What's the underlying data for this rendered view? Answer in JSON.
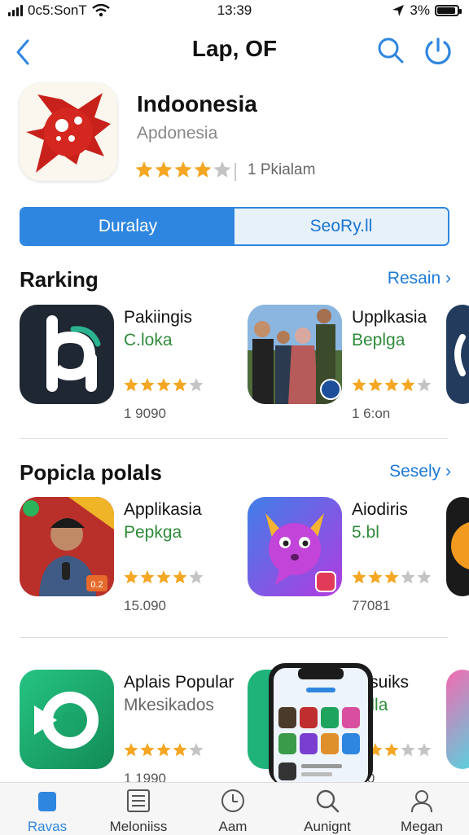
{
  "status_bar": {
    "carrier": "0с5:SonT",
    "time": "13:39",
    "battery": "3%",
    "battery_level": 0.9
  },
  "nav": {
    "title": "Lap, OF",
    "back_icon": "chevron-left-icon",
    "search_icon": "search-icon",
    "power_icon": "power-icon"
  },
  "featured": {
    "title": "Indoonesia",
    "subtitle": "Apdonesia",
    "rating": 4,
    "count": "1 Pkialam"
  },
  "segments": {
    "active": "Duralay",
    "inactive": "SeoRy.ll"
  },
  "ranking": {
    "title": "Rarking",
    "link": "Resain"
  },
  "popular": {
    "title": "Popicla polals",
    "link": "Sesely"
  },
  "ranking_apps": [
    {
      "name": "Pakiingis",
      "dev": "C.loka",
      "rating": 4,
      "count": "1 9090"
    },
    {
      "name": "Upplkasia",
      "dev": "Beplga",
      "rating": 4,
      "count": "1 6:on"
    }
  ],
  "popular_apps": [
    {
      "name": "Applikasia",
      "dev": "Pepkga",
      "rating": 4,
      "count": "15.090",
      "badge": "0.2"
    },
    {
      "name": "Aiodiris",
      "dev": "5.bl",
      "rating": 3,
      "count": "77081"
    }
  ],
  "third_row": [
    {
      "name": "Aplais Popular",
      "dev": "Mkesikados",
      "rating": 4,
      "count": "1 1990"
    },
    {
      "name": "sesuiks",
      "dev": "dalla",
      "rating": 3,
      "count": "990"
    }
  ],
  "tabs": [
    {
      "label": "Ravas",
      "icon": "today-card-icon"
    },
    {
      "label": "Meloniiss",
      "icon": "list-icon"
    },
    {
      "label": "Aam",
      "icon": "clock-icon"
    },
    {
      "label": "Aunignt",
      "icon": "search-icon"
    },
    {
      "label": "Megan",
      "icon": "person-icon"
    }
  ],
  "colors": {
    "accent": "#2f86e0",
    "star": "#f5a623",
    "developer": "#2e8b3a"
  }
}
